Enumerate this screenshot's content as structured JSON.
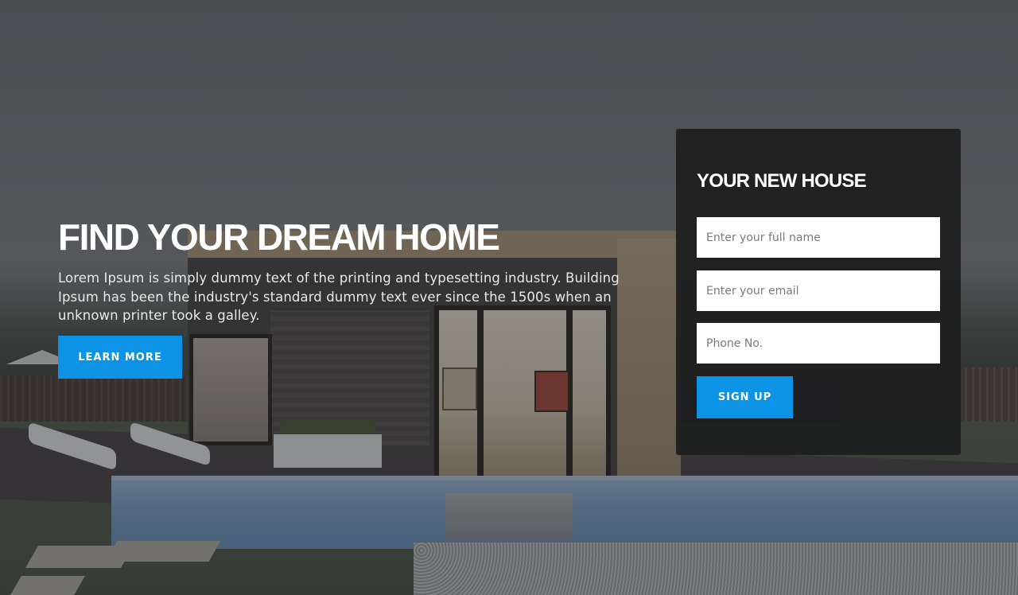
{
  "hero": {
    "title": "FIND YOUR DREAM HOME",
    "description": "Lorem Ipsum is simply dummy text of the printing and typesetting industry. Building Ipsum has been the industry's standard dummy text ever since the 1500s when an unknown printer took a galley.",
    "cta_label": "LEARN MORE"
  },
  "signup": {
    "title": "YOUR NEW HOUSE",
    "name_placeholder": "Enter your full name",
    "email_placeholder": "Enter your email",
    "phone_placeholder": "Phone No.",
    "submit_label": "SIGN UP"
  },
  "colors": {
    "accent": "#0d93e6",
    "panel_bg": "#1e1e1f",
    "text_light": "#ffffff"
  }
}
